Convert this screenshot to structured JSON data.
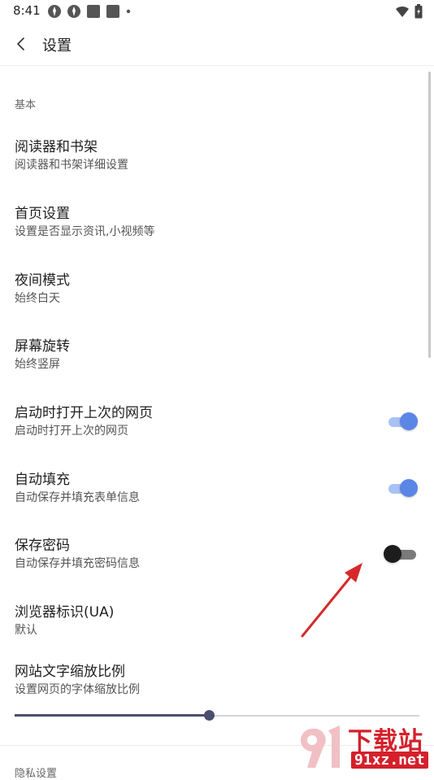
{
  "status_bar": {
    "time": "8:41"
  },
  "header": {
    "title": "设置"
  },
  "section_basic": {
    "label": "基本"
  },
  "items": [
    {
      "title": "阅读器和书架",
      "subtitle": "阅读器和书架详细设置"
    },
    {
      "title": "首页设置",
      "subtitle": "设置是否显示资讯,小视频等"
    },
    {
      "title": "夜间模式",
      "subtitle": "始终白天"
    },
    {
      "title": "屏幕旋转",
      "subtitle": "始终竖屏"
    },
    {
      "title": "启动时打开上次的网页",
      "subtitle": "启动时打开上次的网页",
      "toggle": true
    },
    {
      "title": "自动填充",
      "subtitle": "自动保存并填充表单信息",
      "toggle": true
    },
    {
      "title": "保存密码",
      "subtitle": "自动保存并填充密码信息",
      "toggle": false
    },
    {
      "title": "浏览器标识(UA)",
      "subtitle": "默认"
    },
    {
      "title": "网站文字缩放比例",
      "subtitle": "设置网页的字体缩放比例"
    }
  ],
  "font_scale_slider": {
    "value_fraction": 0.48
  },
  "next_section": {
    "label": "隐私设置"
  },
  "watermark": {
    "text": "下载站",
    "domain": "91xz.net"
  },
  "colors": {
    "toggle_on": "#5b86e5",
    "toggle_off": "#1d1d1d",
    "slider": "#4a4f6e",
    "annotation_arrow": "#d42a2a",
    "watermark": "#d4202b"
  }
}
